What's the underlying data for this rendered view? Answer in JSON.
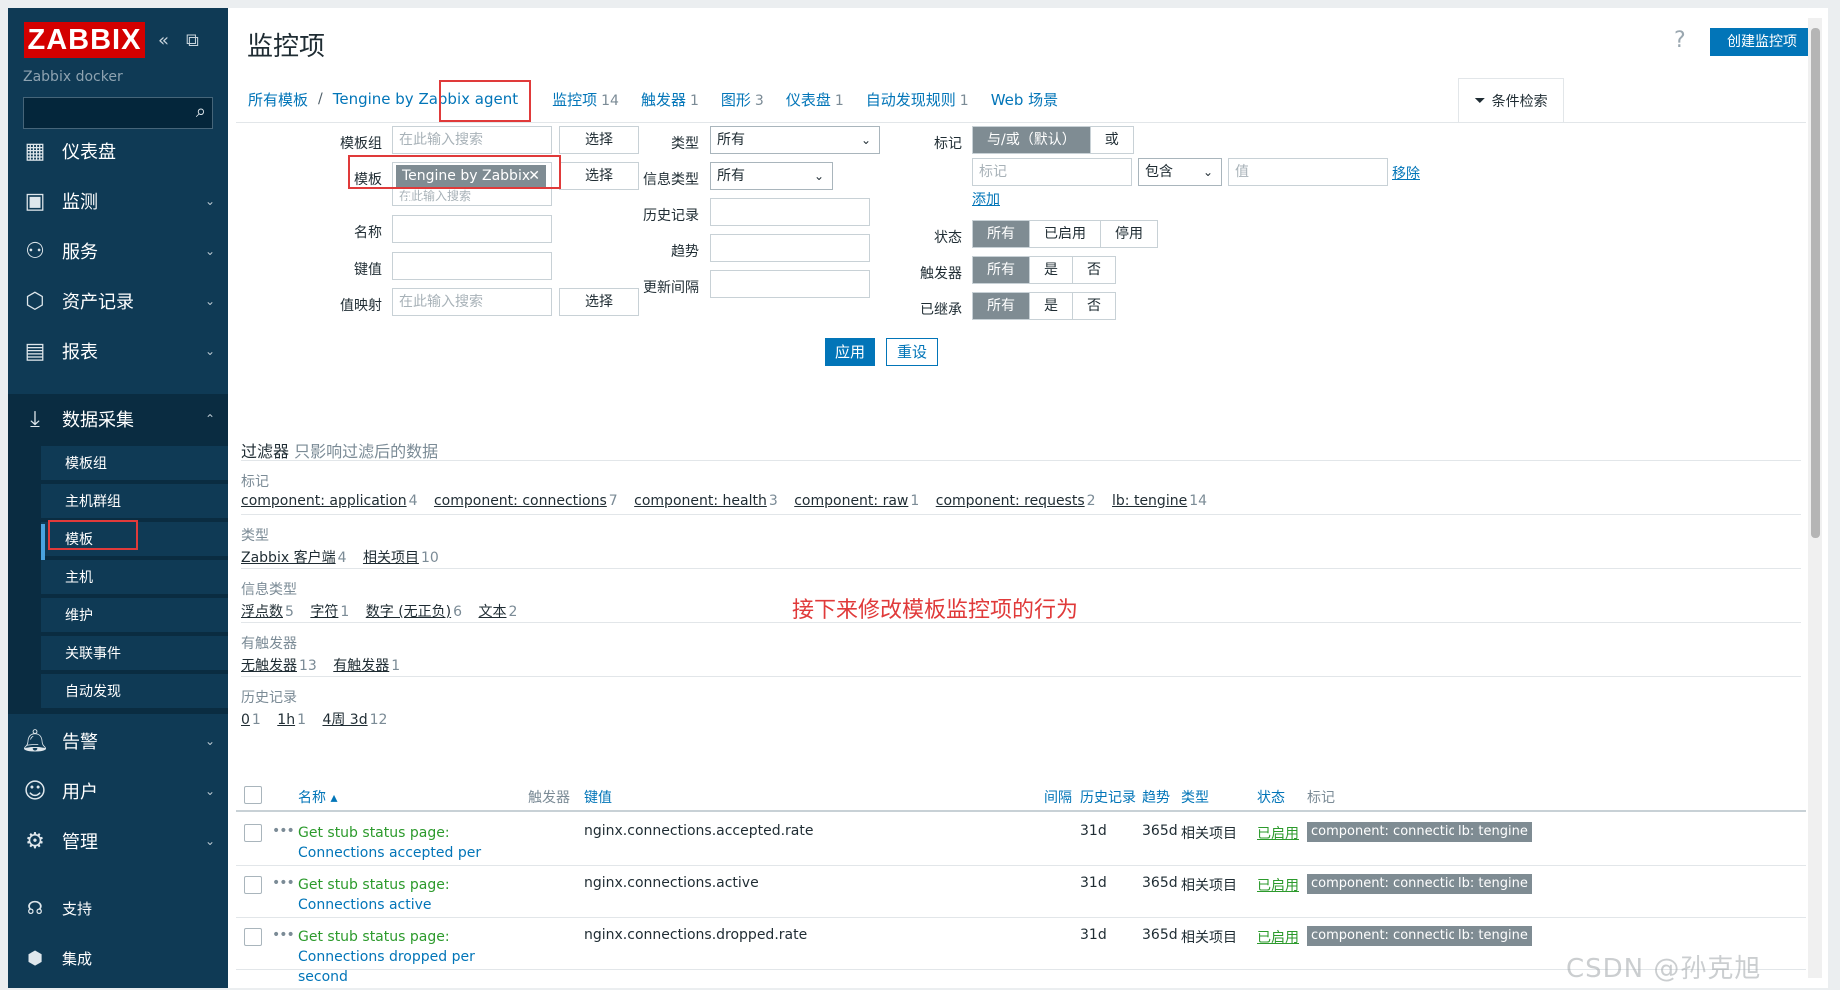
{
  "sidebar": {
    "logo": "ZABBIX",
    "server_name": "Zabbix docker",
    "menu": [
      {
        "label": "仪表盘",
        "icon": "dashboard-icon"
      },
      {
        "label": "监测",
        "icon": "monitoring-icon"
      },
      {
        "label": "服务",
        "icon": "services-icon"
      },
      {
        "label": "资产记录",
        "icon": "inventory-icon"
      },
      {
        "label": "报表",
        "icon": "reports-icon"
      },
      {
        "label": "数据采集",
        "icon": "data-collection-icon"
      }
    ],
    "submenu": [
      "模板组",
      "主机群组",
      "模板",
      "主机",
      "维护",
      "关联事件",
      "自动发现"
    ],
    "menu_after": [
      {
        "label": "告警",
        "icon": "bell-icon"
      },
      {
        "label": "用户",
        "icon": "users-icon"
      },
      {
        "label": "管理",
        "icon": "gear-icon"
      }
    ],
    "bottom": [
      {
        "label": "支持",
        "icon": "headset-icon"
      },
      {
        "label": "集成",
        "icon": "integrations-icon"
      }
    ]
  },
  "header": {
    "title": "监控项",
    "help": "?",
    "create_button": "创建监控项"
  },
  "breadcrumb": {
    "all_templates": "所有模板",
    "separator": "/",
    "template": "Tengine by Zabbix agent"
  },
  "tabs": [
    {
      "label": "监控项",
      "count": "14"
    },
    {
      "label": "触发器",
      "count": "1"
    },
    {
      "label": "图形",
      "count": "3"
    },
    {
      "label": "仪表盘",
      "count": "1"
    },
    {
      "label": "自动发现规则",
      "count": "1"
    },
    {
      "label": "Web 场景",
      "count": ""
    }
  ],
  "filter_tab": "条件检索",
  "filter": {
    "template_group_label": "模板组",
    "template_group_placeholder": "在此输入搜索",
    "select": "选择",
    "template_label": "模板",
    "template_chip": "Tengine by Zabbix a...",
    "template_placeholder": "在此输入搜索",
    "name_label": "名称",
    "key_label": "键值",
    "valuemap_label": "值映射",
    "valuemap_placeholder": "在此输入搜索",
    "type_label": "类型",
    "type_value": "所有",
    "info_type_label": "信息类型",
    "info_type_value": "所有",
    "history_label": "历史记录",
    "trends_label": "趋势",
    "interval_label": "更新间隔",
    "tags_label": "标记",
    "tag_and_or": "与/或（默认）",
    "tag_or": "或",
    "tag_name_placeholder": "标记",
    "tag_operator": "包含",
    "tag_value_placeholder": "值",
    "remove": "移除",
    "add": "添加",
    "status_label": "状态",
    "status_options": [
      "所有",
      "已启用",
      "停用"
    ],
    "triggers_label": "触发器",
    "triggers_options": [
      "所有",
      "是",
      "否"
    ],
    "inherited_label": "已继承",
    "inherited_options": [
      "所有",
      "是",
      "否"
    ],
    "apply": "应用",
    "reset": "重设"
  },
  "subfilter": {
    "title": "过滤器",
    "note": "只影响过滤后的数据",
    "groups": [
      {
        "title": "标记",
        "items": [
          {
            "label": "component: application",
            "count": "4"
          },
          {
            "label": "component: connections",
            "count": "7"
          },
          {
            "label": "component: health",
            "count": "3"
          },
          {
            "label": "component: raw",
            "count": "1"
          },
          {
            "label": "component: requests",
            "count": "2"
          },
          {
            "label": "lb: tengine",
            "count": "14"
          }
        ]
      },
      {
        "title": "类型",
        "items": [
          {
            "label": "Zabbix 客户端",
            "count": "4"
          },
          {
            "label": "相关项目",
            "count": "10"
          }
        ]
      },
      {
        "title": "信息类型",
        "items": [
          {
            "label": "浮点数",
            "count": "5"
          },
          {
            "label": "字符",
            "count": "1"
          },
          {
            "label": "数字 (无正负)",
            "count": "6"
          },
          {
            "label": "文本",
            "count": "2"
          }
        ]
      },
      {
        "title": "有触发器",
        "items": [
          {
            "label": "无触发器",
            "count": "13"
          },
          {
            "label": "有触发器",
            "count": "1"
          }
        ]
      },
      {
        "title": "历史记录",
        "items": [
          {
            "label": "0",
            "count": "1"
          },
          {
            "label": "1h",
            "count": "1"
          },
          {
            "label": "4周 3d",
            "count": "12"
          }
        ]
      }
    ]
  },
  "annotation": "接下来修改模板监控项的行为",
  "table": {
    "headers": {
      "name": "名称 ▴",
      "triggers": "触发器",
      "key": "键值",
      "interval": "间隔",
      "history": "历史记录",
      "trends": "趋势",
      "type": "类型",
      "status": "状态",
      "tags": "标记"
    },
    "rows": [
      {
        "prefix": "Get stub status page:",
        "name": "Connections accepted per second",
        "key": "nginx.connections.accepted.rate",
        "history": "31d",
        "trends": "365d",
        "type": "相关项目",
        "status": "已启用",
        "tags": [
          "component: connections",
          "lb: tengine"
        ]
      },
      {
        "prefix": "Get stub status page:",
        "name": "Connections active",
        "key": "nginx.connections.active",
        "history": "31d",
        "trends": "365d",
        "type": "相关项目",
        "status": "已启用",
        "tags": [
          "component: connections",
          "lb: tengine"
        ]
      },
      {
        "prefix": "Get stub status page:",
        "name": "Connections dropped per second",
        "key": "nginx.connections.dropped.rate",
        "history": "31d",
        "trends": "365d",
        "type": "相关项目",
        "status": "已启用",
        "tags": [
          "component: connections",
          "lb: tengine"
        ]
      }
    ]
  },
  "watermark": "CSDN @孙克旭"
}
